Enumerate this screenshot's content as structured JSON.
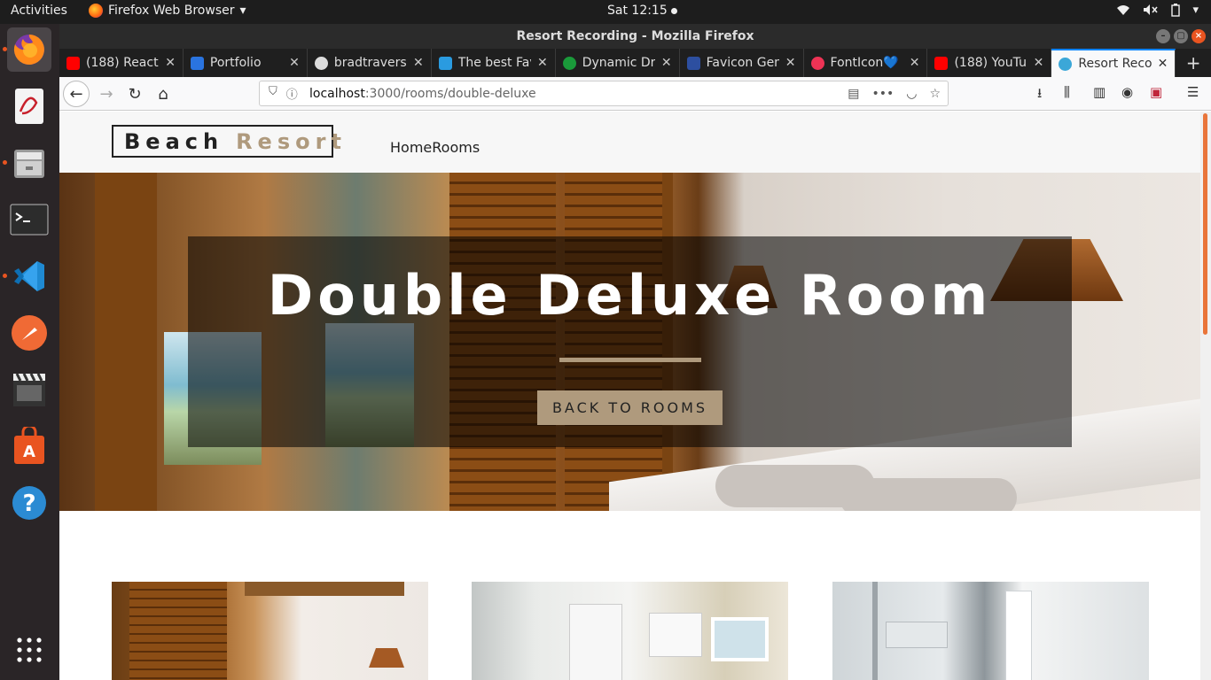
{
  "topbar": {
    "activities": "Activities",
    "app_menu": "Firefox Web Browser",
    "clock": "Sat 12:15"
  },
  "dock": {
    "items": [
      "firefox-icon",
      "document-viewer-icon",
      "file-manager-icon",
      "terminal-icon",
      "vscode-icon",
      "postman-icon",
      "video-editor-icon",
      "software-center-icon",
      "help-icon",
      "app-grid-icon"
    ]
  },
  "window": {
    "title": "Resort Recording - Mozilla Firefox"
  },
  "tabs": [
    {
      "label": "(188) React",
      "icon_color": "#ff0000"
    },
    {
      "label": "Portfolio",
      "icon_color": "#2a74e0"
    },
    {
      "label": "bradtraversy",
      "icon_color": "#222222"
    },
    {
      "label": "The best Fav",
      "icon_color": "#2a9be0"
    },
    {
      "label": "Dynamic Dri",
      "icon_color": "#1a9a3a"
    },
    {
      "label": "Favicon Gen",
      "icon_color": "#2d4fa0"
    },
    {
      "label": "FontIcon💙",
      "icon_color": "#ee3355"
    },
    {
      "label": "(188) YouTu",
      "icon_color": "#ff0000"
    },
    {
      "label": "Resort Reco",
      "icon_color": "#3ba7d8"
    }
  ],
  "url": {
    "host": "localhost",
    "path": ":3000/rooms/double-deluxe"
  },
  "site": {
    "logo_main": "Beach",
    "logo_accent": "Resort",
    "nav": [
      "Home",
      "Rooms"
    ],
    "hero_title": "Double Deluxe Room",
    "back_button": "BACK TO ROOMS",
    "accent_color": "#af9a7d"
  }
}
